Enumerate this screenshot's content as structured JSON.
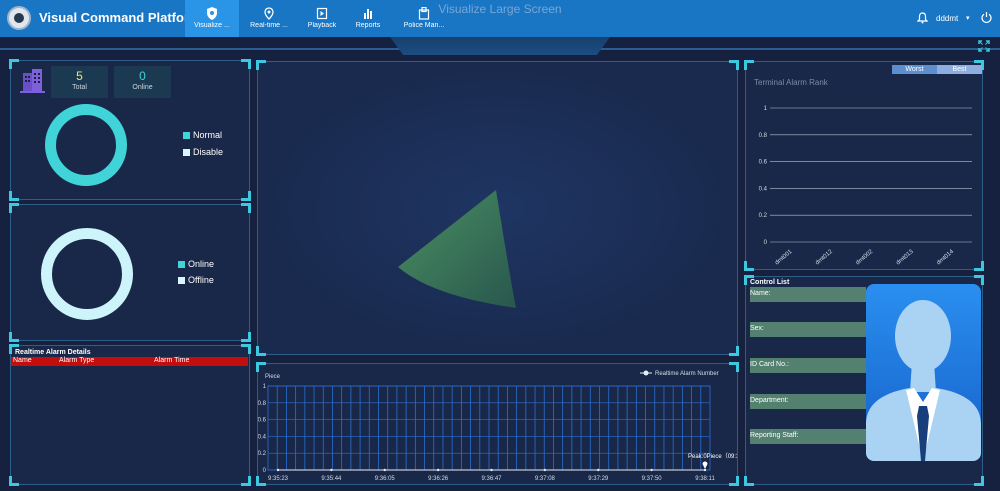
{
  "app": {
    "title": "Visual Command Platform"
  },
  "nav": {
    "tabs": [
      {
        "label": "Visualize ...",
        "icon": "shield-icon",
        "active": true
      },
      {
        "label": "Real-time ...",
        "icon": "map-pin-icon",
        "active": false
      },
      {
        "label": "Playback",
        "icon": "playback-icon",
        "active": false
      },
      {
        "label": "Reports",
        "icon": "bar-chart-icon",
        "active": false
      },
      {
        "label": "Police Man...",
        "icon": "police-icon",
        "active": false
      }
    ]
  },
  "user": {
    "name": "dddmt",
    "caret": "▾"
  },
  "screen": {
    "title": "Visualize Large Screen"
  },
  "device_stats": {
    "total_value": "5",
    "total_label": "Total",
    "online_value": "0",
    "online_label": "Online",
    "legend": [
      {
        "label": "Normal",
        "color": "#40d3d8"
      },
      {
        "label": "Disable",
        "color": "#d9f6ff"
      }
    ]
  },
  "online_stats": {
    "legend": [
      {
        "label": "Online",
        "color": "#40d3d8"
      },
      {
        "label": "Offline",
        "color": "#d9f6ff"
      }
    ]
  },
  "alarm_details": {
    "title": "Realtime Alarm Details",
    "columns": [
      "Name",
      "Alarm Type",
      "Alarm Time"
    ]
  },
  "rank": {
    "worst_label": "Worst",
    "best_label": "Best",
    "title": "Terminal Alarm Rank"
  },
  "control_list": {
    "title": "Control List",
    "fields": [
      "Name:",
      "Sex:",
      "ID Card No.:",
      "Department:",
      "Reporting Staff:"
    ]
  },
  "chart_data": [
    {
      "type": "bar",
      "title": "Terminal Alarm Rank",
      "categories": [
        "dmt001",
        "dmt012",
        "dmt002",
        "dmt013",
        "dmt014"
      ],
      "values": [
        0,
        0,
        0,
        0,
        0
      ],
      "ylim": [
        0,
        1
      ],
      "yticks": [
        "0",
        "0.2",
        "0.4",
        "0.6",
        "0.8",
        "1"
      ],
      "grid": true
    },
    {
      "type": "line",
      "ylabel": "Piece",
      "legend": "Realtime Alarm Number",
      "x": [
        "9:35:23",
        "9:35:44",
        "9:36:05",
        "9:36:26",
        "9:36:47",
        "9:37:08",
        "9:37:29",
        "9:37:50",
        "9:38:11"
      ],
      "values": [
        0,
        0,
        0,
        0,
        0,
        0,
        0,
        0,
        0
      ],
      "ylim": [
        0,
        1
      ],
      "yticks": [
        "0",
        "0.2",
        "0.4",
        "0.6",
        "0.8",
        "1"
      ],
      "peak_label": "Peak:0Piece（09:3",
      "grid": true
    }
  ]
}
